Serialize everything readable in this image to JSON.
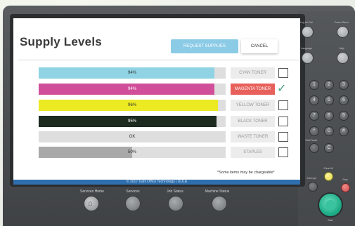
{
  "screen": {
    "title": "Supply Levels",
    "request_button": "REQUEST SUPPLIES",
    "cancel_button": "CANCEL",
    "note": "*Some items may be chargeable*",
    "footer": "© 2017 Dahl Office Technology | UULA"
  },
  "supplies": [
    {
      "name": "CYAN TONER",
      "value_text": "94%",
      "level": 0.94,
      "color": "#8fd3e4",
      "text_light": false,
      "checked": false,
      "active": false
    },
    {
      "name": "MAGENTA TONER",
      "value_text": "94%",
      "level": 0.94,
      "color": "#d14f9a",
      "text_light": true,
      "checked": true,
      "active": true
    },
    {
      "name": "YELLOW TONER",
      "value_text": "96%",
      "level": 0.96,
      "color": "#ecea22",
      "text_light": false,
      "checked": false,
      "active": false
    },
    {
      "name": "BLACK TONER",
      "value_text": "95%",
      "level": 0.95,
      "color": "#1c2a20",
      "text_light": true,
      "checked": false,
      "active": false
    },
    {
      "name": "WASTE TONER",
      "value_text": "OK",
      "level": 0.0,
      "color": "#dedede",
      "text_light": false,
      "checked": false,
      "active": false
    },
    {
      "name": "STAPLES",
      "value_text": "50%",
      "level": 0.5,
      "color": "#a9a9a9",
      "text_light": false,
      "checked": false,
      "active": false
    }
  ],
  "hardware": {
    "bottom_buttons": [
      {
        "label": "Services Home"
      },
      {
        "label": "Services"
      },
      {
        "label": "Job Status"
      },
      {
        "label": "Machine Status"
      }
    ],
    "keypad_top": [
      "Log In/ Out",
      "Power Saver"
    ],
    "keypad_mid": [
      "Language",
      "Help"
    ],
    "keys": [
      "1",
      "2",
      "3",
      "4",
      "5",
      "6",
      "7",
      "8",
      "9",
      "*",
      "0",
      "#"
    ],
    "dial_pause": "Dial Pause",
    "clear_all": "Clear All",
    "interrupt": "Interrupt",
    "stop": "Stop",
    "start": "Start",
    "key_c": "C"
  },
  "colors": {
    "accent_blue": "#8ccbe6",
    "alert_red": "#e8605b",
    "footer_blue": "#2f6fae",
    "start_green": "#1fae89"
  }
}
